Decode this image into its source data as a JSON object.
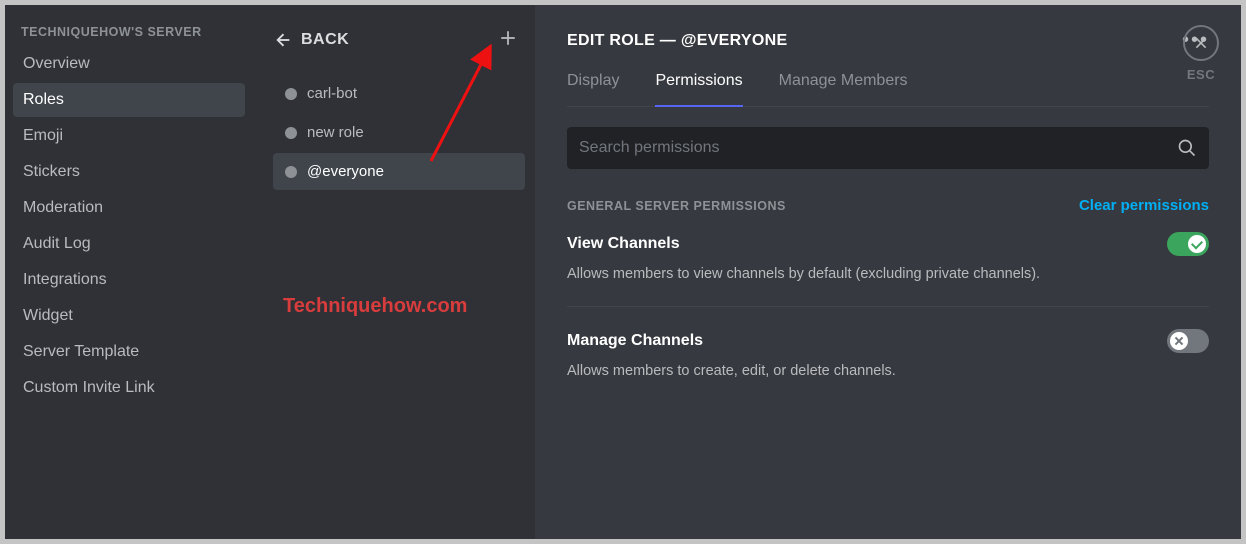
{
  "sidebar": {
    "server_title": "TECHNIQUEHOW'S SERVER",
    "items": [
      {
        "label": "Overview",
        "active": false
      },
      {
        "label": "Roles",
        "active": true
      },
      {
        "label": "Emoji",
        "active": false
      },
      {
        "label": "Stickers",
        "active": false
      },
      {
        "label": "Moderation",
        "active": false
      },
      {
        "label": "Audit Log",
        "active": false
      },
      {
        "label": "Integrations",
        "active": false
      },
      {
        "label": "Widget",
        "active": false
      },
      {
        "label": "Server Template",
        "active": false
      },
      {
        "label": "Custom Invite Link",
        "active": false
      }
    ]
  },
  "roles_panel": {
    "back_label": "BACK",
    "roles": [
      {
        "name": "carl-bot",
        "active": false
      },
      {
        "name": "new role",
        "active": false
      },
      {
        "name": "@everyone",
        "active": true
      }
    ]
  },
  "watermark": "Techniquehow.com",
  "main": {
    "title": "EDIT ROLE — @EVERYONE",
    "tabs": [
      {
        "label": "Display",
        "active": false
      },
      {
        "label": "Permissions",
        "active": true
      },
      {
        "label": "Manage Members",
        "active": false
      }
    ],
    "search_placeholder": "Search permissions",
    "section_title": "GENERAL SERVER PERMISSIONS",
    "clear_label": "Clear permissions",
    "permissions": [
      {
        "name": "View Channels",
        "desc": "Allows members to view channels by default (excluding private channels).",
        "enabled": true
      },
      {
        "name": "Manage Channels",
        "desc": "Allows members to create, edit, or delete channels.",
        "enabled": false
      }
    ]
  },
  "esc_label": "ESC"
}
